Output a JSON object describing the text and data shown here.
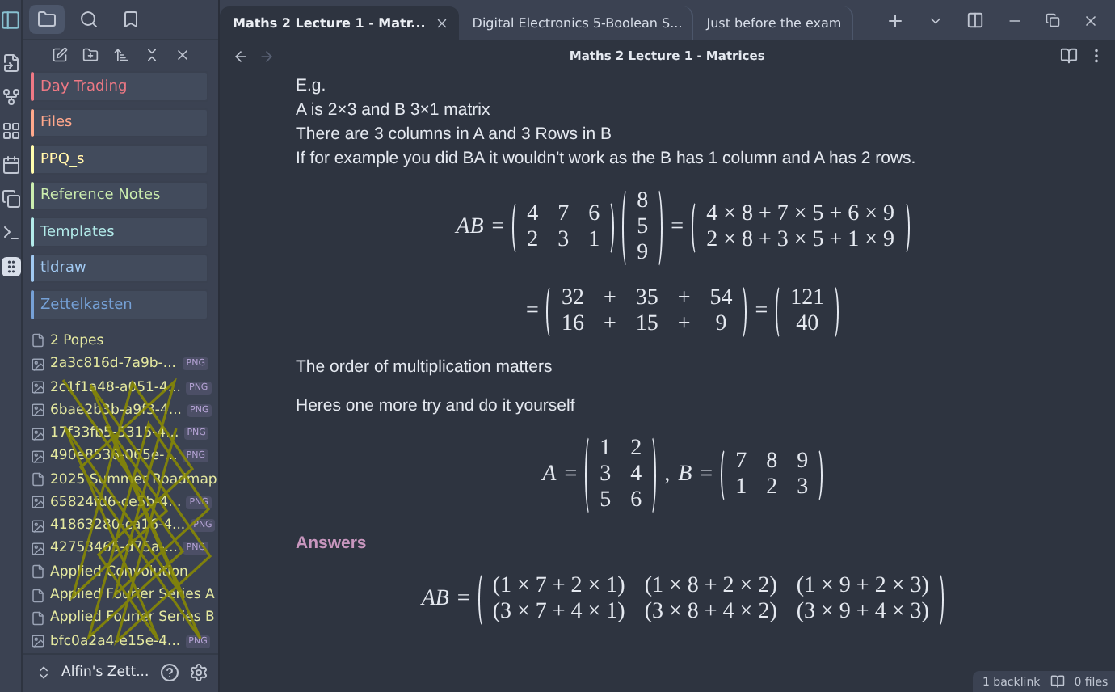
{
  "sidebar": {
    "tabs": [
      {
        "selected": true
      },
      {
        "selected": false
      },
      {
        "selected": false
      }
    ],
    "folders": [
      {
        "name": "Day Trading",
        "color": "#bf616a"
      },
      {
        "name": "Files",
        "color": "#d08770"
      },
      {
        "name": "PPQ_s",
        "color": "#ebcb8b"
      },
      {
        "name": "Reference Notes",
        "color": "#a3be8c"
      },
      {
        "name": "Templates",
        "color": "#8fbcbb"
      },
      {
        "name": "tldraw",
        "color": "#81a1c1"
      },
      {
        "name": "Zettelkasten",
        "color": "#5e81ac"
      }
    ],
    "files": [
      {
        "name": "2 Popes",
        "kind": "note"
      },
      {
        "name": "2a3c816d-7a9b-...",
        "kind": "image",
        "badge": "PNG"
      },
      {
        "name": "2c1f1a48-a051-4...",
        "kind": "image",
        "badge": "PNG"
      },
      {
        "name": "6bae2b3b-a9f3-4...",
        "kind": "image",
        "badge": "PNG"
      },
      {
        "name": "17f33fb5-5315-4...",
        "kind": "image",
        "badge": "PNG"
      },
      {
        "name": "490e8536-065e-...",
        "kind": "image",
        "badge": "PNG"
      },
      {
        "name": "2025 Summer Roadmap",
        "kind": "note"
      },
      {
        "name": "65824fd6-ce5b-4...",
        "kind": "image",
        "badge": "PNG"
      },
      {
        "name": "41863280-ca16-4...",
        "kind": "image",
        "badge": "PNG"
      },
      {
        "name": "42753465-d75a-...",
        "kind": "image",
        "badge": "PNG"
      },
      {
        "name": "Applied Convolution",
        "kind": "note"
      },
      {
        "name": "Applied Fourier Series A",
        "kind": "note"
      },
      {
        "name": "Applied Fourier Series B",
        "kind": "note"
      },
      {
        "name": "bfc0a2a4-e15e-4...",
        "kind": "image",
        "badge": "PNG"
      }
    ],
    "vault": "Alfin's Zett..."
  },
  "tabs": [
    {
      "label": "Maths 2 Lecture 1 - Matr...",
      "selected": true
    },
    {
      "label": "Digital Electronics 5-Boolean S...",
      "selected": false
    },
    {
      "label": "Just before the exam",
      "selected": false
    }
  ],
  "note_title": "Maths 2 Lecture 1 - Matrices",
  "content": [
    {
      "kind": "line",
      "text": "E.g."
    },
    {
      "kind": "line",
      "text": "A is 2×3 and B 3×1 matrix"
    },
    {
      "kind": "line",
      "text": "There are 3 columns in A and 3 Rows in B"
    },
    {
      "kind": "line",
      "text": "If for example you did BA it wouldn't work as the B has 1 column and A has 2 rows."
    },
    {
      "kind": "equation",
      "terms": [
        {
          "kind": "var",
          "text": "AB"
        },
        {
          "kind": "op",
          "text": "="
        },
        {
          "kind": "matrix",
          "rows": [
            [
              "4",
              "7",
              "6"
            ],
            [
              "2",
              "3",
              "1"
            ]
          ]
        },
        {
          "kind": "matrix",
          "rows": [
            [
              "8"
            ],
            [
              "5"
            ],
            [
              "9"
            ]
          ]
        },
        {
          "kind": "op",
          "text": "="
        },
        {
          "kind": "matrix",
          "rows": [
            [
              "4 × 8 + 7 × 5 + 6 × 9"
            ],
            [
              "2 × 8 + 3 × 5 + 1 × 9"
            ]
          ]
        }
      ]
    },
    {
      "kind": "equation",
      "terms": [
        {
          "kind": "op",
          "text": "="
        },
        {
          "kind": "matrix",
          "rows": [
            [
              "32",
              "+",
              "35",
              "+",
              "54"
            ],
            [
              "16",
              "+",
              "15",
              "+",
              "9"
            ]
          ]
        },
        {
          "kind": "op",
          "text": "="
        },
        {
          "kind": "matrix",
          "rows": [
            [
              "121"
            ],
            [
              "40"
            ]
          ]
        }
      ]
    },
    {
      "kind": "paragraph",
      "text": "The order of multiplication matters"
    },
    {
      "kind": "paragraph",
      "text": "Heres one more try and do it yourself"
    },
    {
      "kind": "equation",
      "terms": [
        {
          "kind": "var",
          "text": "A"
        },
        {
          "kind": "op",
          "text": "="
        },
        {
          "kind": "matrix",
          "rows": [
            [
              "1",
              "2"
            ],
            [
              "3",
              "4"
            ],
            [
              "5",
              "6"
            ]
          ]
        },
        {
          "kind": "op",
          "text": ","
        },
        {
          "kind": "var",
          "text": "B"
        },
        {
          "kind": "op",
          "text": "="
        },
        {
          "kind": "matrix",
          "rows": [
            [
              "7",
              "8",
              "9"
            ],
            [
              "1",
              "2",
              "3"
            ]
          ]
        }
      ]
    },
    {
      "kind": "heading",
      "text": "Answers"
    },
    {
      "kind": "equation",
      "terms": [
        {
          "kind": "var",
          "text": "AB"
        },
        {
          "kind": "op",
          "text": "="
        },
        {
          "kind": "matrix",
          "rows": [
            [
              "(1 × 7 + 2 × 1)",
              "(1 × 8 + 2 × 2)",
              "(1 × 9 + 2 × 3)"
            ],
            [
              "(3 × 7 + 4 × 1)",
              "(3 × 8 + 4 × 2)",
              "(3 × 9 + 4 × 3)"
            ]
          ]
        }
      ]
    }
  ],
  "status_bar": {
    "backlinks": "1 backlink",
    "files": "0 files"
  }
}
